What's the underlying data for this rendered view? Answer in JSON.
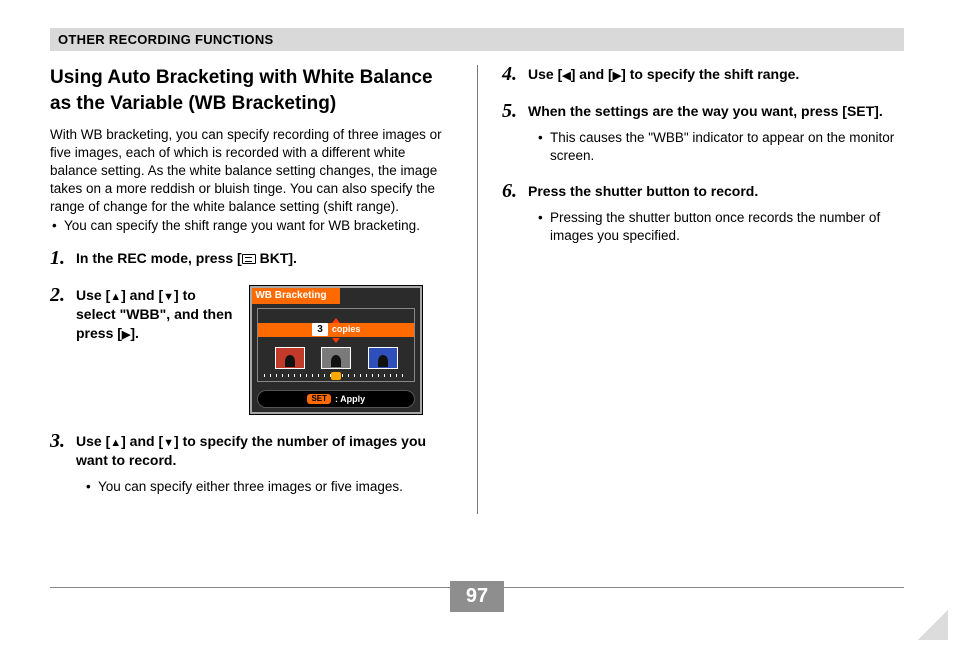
{
  "header": {
    "section_title": "OTHER RECORDING FUNCTIONS"
  },
  "left": {
    "title": "Using Auto Bracketing with White Balance as the Variable (WB Bracketing)",
    "intro": "With WB bracketing, you can specify recording of three images or five images, each of which is recorded with a different white balance setting. As the white balance setting changes, the image takes on a more reddish or bluish tinge. You can also specify the range of change for the white balance setting (shift range).",
    "intro_bullet": "You can specify the shift range you want for WB bracketing.",
    "steps": {
      "s1_a": "In the REC mode, press [",
      "s1_b": " BKT].",
      "s2_a": "Use [",
      "s2_b": "] and [",
      "s2_c": "] to select \"WBB\", and then press [",
      "s2_d": "].",
      "s3_a": "Use [",
      "s3_b": "] and [",
      "s3_c": "] to specify the number of images you want to record.",
      "s3_bullet": "You can specify either three images or five images."
    }
  },
  "right": {
    "s4_a": "Use [",
    "s4_b": "] and [",
    "s4_c": "] to specify the shift range.",
    "s5": "When the settings are the way you want, press [SET].",
    "s5_bullet": "This causes the \"WBB\" indicator to appear on the monitor screen.",
    "s6": "Press the shutter button to record.",
    "s6_bullet": "Pressing the shutter button once records the number of images you specified."
  },
  "lcd": {
    "title": "WB Bracketing",
    "copies_num": "3",
    "copies_label": "copies",
    "set": "SET",
    "apply": ": Apply"
  },
  "page_number": "97"
}
